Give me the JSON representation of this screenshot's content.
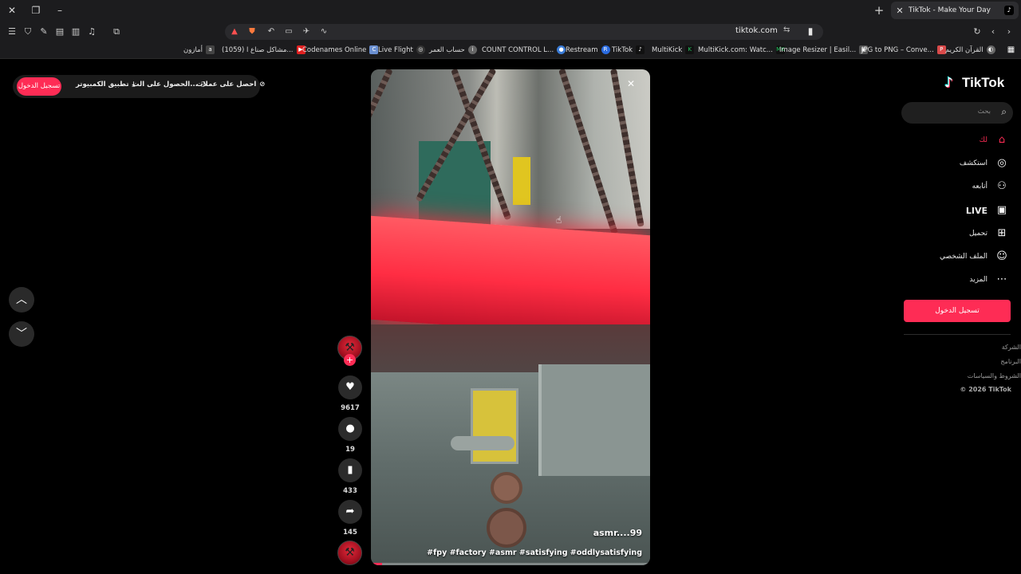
{
  "browser": {
    "tab_title": "TikTok - Make Your Day",
    "url": "tiktok.com",
    "bookmarks": [
      {
        "label": "أمازون",
        "color": "#444"
      },
      {
        "label": "(1059) مشاكل صناع ا...",
        "color": "#e02020"
      },
      {
        "label": "Codenames Online",
        "color": "#6a8fd0"
      },
      {
        "label": "Live Flight",
        "color": "#888"
      },
      {
        "label": "حساب العمر",
        "color": "#888"
      },
      {
        "label": "COUNT CONTROL L...",
        "color": "#3a7bd5"
      },
      {
        "label": "Restream",
        "color": "#2a6be0"
      },
      {
        "label": "TikTok",
        "color": "#111"
      },
      {
        "label": "MultiKick",
        "color": "#22c55e"
      },
      {
        "label": "MultiKick.com: Watc...",
        "color": "#22c55e"
      },
      {
        "label": "Image Resizer | Easil...",
        "color": "#555"
      },
      {
        "label": "JPG to PNG – Conve...",
        "color": "#d94a4a"
      },
      {
        "label": "القرآن الكريم",
        "color": "#666"
      }
    ]
  },
  "topbar": {
    "login_label": "تسجيل الدخول",
    "desktop_app_label": "تطبيق الكمبيوتر",
    "get_app_label": "الحصول على الت...",
    "coins_label": "احصل على عملات"
  },
  "video": {
    "username": "asmr....99",
    "description": "#fpy #factory #asmr #satisfying #oddlysatisfying",
    "progress": 0.04
  },
  "actions": {
    "likes": "9617",
    "comments": "19",
    "saves": "433",
    "shares": "145"
  },
  "sidebar": {
    "logo_text": "TikTok",
    "search_placeholder": "بحث",
    "items": [
      {
        "label": "لك",
        "icon": "home-icon",
        "active": true
      },
      {
        "label": "استكشف",
        "icon": "compass-icon",
        "active": false
      },
      {
        "label": "أتابعه",
        "icon": "following-icon",
        "active": false
      },
      {
        "label": "LIVE",
        "icon": "live-icon",
        "active": false
      },
      {
        "label": "تحميل",
        "icon": "upload-icon",
        "active": false
      },
      {
        "label": "الملف الشخصي",
        "icon": "profile-icon",
        "active": false
      },
      {
        "label": "المزيد",
        "icon": "more-icon",
        "active": false
      }
    ],
    "login_label": "تسجيل الدخول",
    "footer": [
      "الشركة",
      "البرنامج",
      "الشروط والسياسات",
      "© 2026 TikTok"
    ]
  },
  "colors": {
    "accent": "#fe2c55",
    "background": "#000000"
  }
}
